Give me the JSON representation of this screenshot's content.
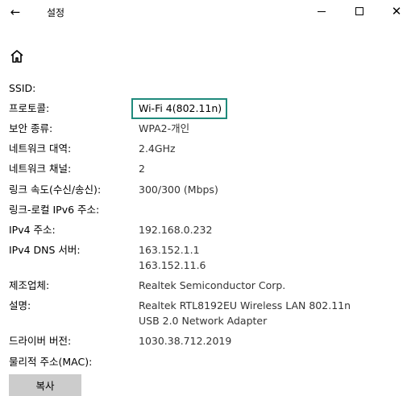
{
  "titlebar": {
    "title": "설정",
    "back_icon": "back-arrow-icon",
    "min_icon": "minimize-icon",
    "max_icon": "maximize-icon",
    "close_icon": "close-icon"
  },
  "home_icon": "home-icon",
  "properties": [
    {
      "label": "SSID:",
      "value": ""
    },
    {
      "label": "프로토콜:",
      "value": "Wi-Fi 4(802.11n)"
    },
    {
      "label": "보안 종류:",
      "value": "WPA2-개인"
    },
    {
      "label": "네트워크 대역:",
      "value": "2.4GHz"
    },
    {
      "label": "네트워크 채널:",
      "value": "2"
    },
    {
      "label": "링크 속도(수신/송신):",
      "value": "300/300 (Mbps)"
    },
    {
      "label": "링크-로컬 IPv6 주소:",
      "value": ""
    },
    {
      "label": "IPv4 주소:",
      "value": "192.168.0.232"
    },
    {
      "label": "IPv4 DNS 서버:",
      "value": "163.152.1.1",
      "value2": "163.152.11.6"
    },
    {
      "label": "제조업체:",
      "value": "Realtek Semiconductor Corp."
    },
    {
      "label": "설명:",
      "value": "Realtek RTL8192EU Wireless LAN 802.11n",
      "value2": "USB 2.0 Network Adapter"
    },
    {
      "label": "드라이버 버전:",
      "value": "1030.38.712.2019"
    },
    {
      "label": "물리적 주소(MAC):",
      "value": ""
    }
  ],
  "copy_button": {
    "label": "복사"
  },
  "colors": {
    "highlight": "#1f8a7c",
    "button_bg": "#cccccc",
    "value_text": "#333333"
  }
}
